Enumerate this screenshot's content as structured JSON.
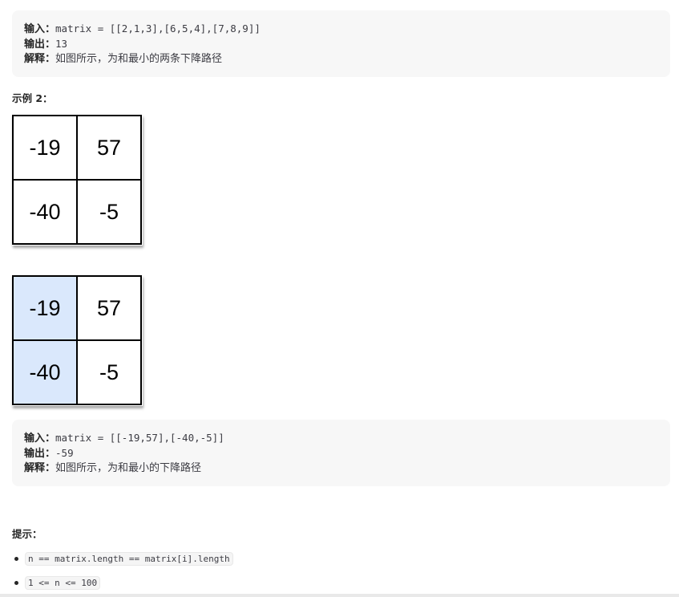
{
  "example1": {
    "input_label": "输入：",
    "input_value": "matrix = [[2,1,3],[6,5,4],[7,8,9]]",
    "output_label": "输出：",
    "output_value": "13",
    "explain_label": "解释：",
    "explain_value": "如图所示，为和最小的两条下降路径"
  },
  "example2": {
    "heading": "示例 2：",
    "grid1": [
      [
        "-19",
        "57"
      ],
      [
        "-40",
        "-5"
      ]
    ],
    "grid2": [
      [
        "-19",
        "57"
      ],
      [
        "-40",
        "-5"
      ]
    ],
    "input_label": "输入：",
    "input_value": "matrix = [[-19,57],[-40,-5]]",
    "output_label": "输出：",
    "output_value": "-59",
    "explain_label": "解释：",
    "explain_value": "如图所示，为和最小的下降路径"
  },
  "hints": {
    "heading": "提示：",
    "items": [
      "n == matrix.length == matrix[i].length",
      "1 <= n <= 100"
    ]
  },
  "colors": {
    "highlight": "#dae8fc",
    "block_bg": "#f7f7f7"
  }
}
